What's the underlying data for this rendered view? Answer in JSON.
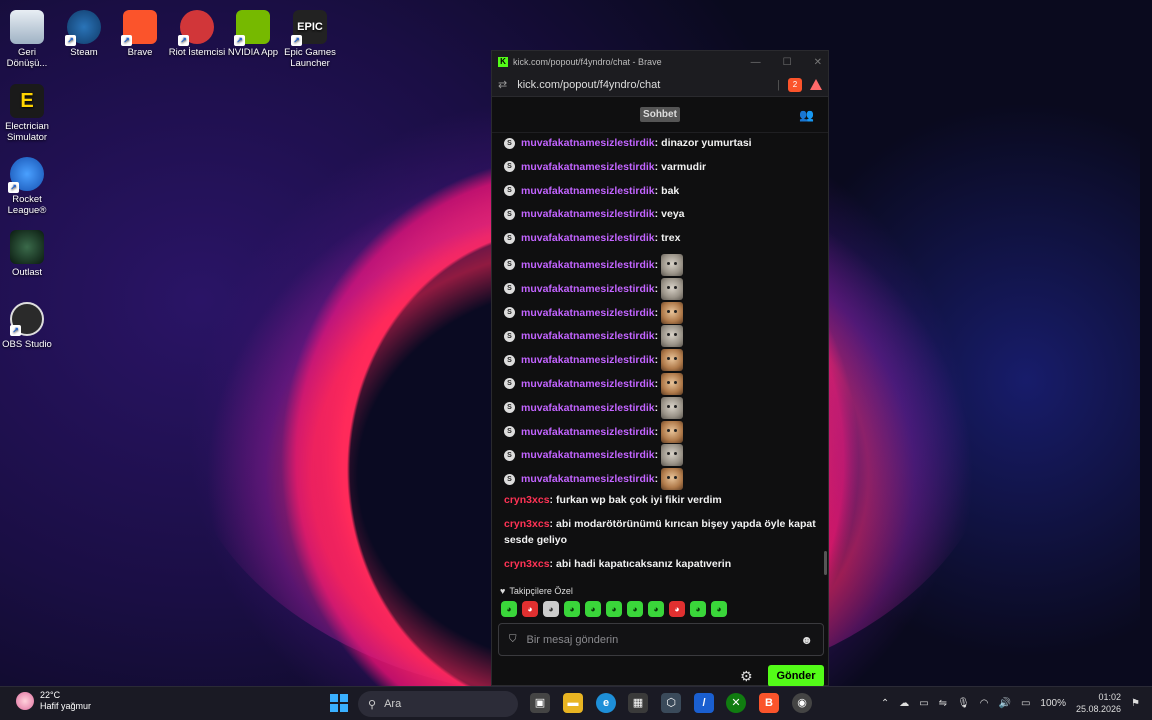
{
  "desktop": {
    "icons": [
      {
        "label": "Geri Dönüşü...",
        "icon": "recycle-bin-icon"
      },
      {
        "label": "Steam",
        "icon": "steam-icon"
      },
      {
        "label": "Brave",
        "icon": "brave-icon"
      },
      {
        "label": "Riot İstemcisi",
        "icon": "riot-icon"
      },
      {
        "label": "NVIDIA App",
        "icon": "nvidia-icon"
      },
      {
        "label": "Epic Games Launcher",
        "icon": "epic-games-icon"
      },
      {
        "label": "Electrician Simulator",
        "icon": "electrician-simulator-icon"
      },
      {
        "label": "Rocket League®",
        "icon": "rocket-league-icon"
      },
      {
        "label": "Outlast",
        "icon": "outlast-icon"
      },
      {
        "label": "OBS Studio",
        "icon": "obs-icon"
      }
    ],
    "epic_logo_text": "EPIC"
  },
  "browser": {
    "window_title": "kick.com/popout/f4yndro/chat - Brave",
    "url": "kick.com/popout/f4yndro/chat",
    "shield_count": "2",
    "accent": "#53fc18"
  },
  "chat": {
    "header_title": "Sohbet",
    "messages": [
      {
        "user": "muvafakatnamesizlestirdik",
        "text": "dinazor yumurtasi",
        "emote": null
      },
      {
        "user": "muvafakatnamesizlestirdik",
        "text": "varmudir",
        "emote": null
      },
      {
        "user": "muvafakatnamesizlestirdik",
        "text": "bak",
        "emote": null
      },
      {
        "user": "muvafakatnamesizlestirdik",
        "text": "veya",
        "emote": null
      },
      {
        "user": "muvafakatnamesizlestirdik",
        "text": "trex",
        "emote": null
      },
      {
        "user": "muvafakatnamesizlestirdik",
        "text": "",
        "emote": "cat-grey"
      },
      {
        "user": "muvafakatnamesizlestirdik",
        "text": "",
        "emote": "cat-grey"
      },
      {
        "user": "muvafakatnamesizlestirdik",
        "text": "",
        "emote": "cat-orange"
      },
      {
        "user": "muvafakatnamesizlestirdik",
        "text": "",
        "emote": "cat-grey"
      },
      {
        "user": "muvafakatnamesizlestirdik",
        "text": "",
        "emote": "cat-orange"
      },
      {
        "user": "muvafakatnamesizlestirdik",
        "text": "",
        "emote": "cat-orange"
      },
      {
        "user": "muvafakatnamesizlestirdik",
        "text": "",
        "emote": "cat-grey"
      },
      {
        "user": "muvafakatnamesizlestirdik",
        "text": "",
        "emote": "cat-orange"
      },
      {
        "user": "muvafakatnamesizlestirdik",
        "text": "",
        "emote": "cat-grey"
      },
      {
        "user": "muvafakatnamesizlestirdik",
        "text": "",
        "emote": "cat-orange"
      }
    ],
    "messages2": [
      {
        "user": "cryn3xcs",
        "text": "furkan wp bak çok iyi fikir verdim"
      },
      {
        "user": "cryn3xcs",
        "text": "abi modarötörünümü kırıcan bişey yapda öyle kapat sesde geliyo"
      },
      {
        "user": "cryn3xcs",
        "text": "abi hadi kapatıcaksanız kapatıverin"
      }
    ],
    "badge_letter": "S",
    "follower_label": "Takipçilere Özel",
    "emotes": [
      "green-emote",
      "red-emote",
      "grey-emote",
      "green-emote",
      "green-emote",
      "green-emote",
      "green-emote",
      "green-emote",
      "red-emote",
      "green-emote",
      "green-emote"
    ],
    "input_placeholder": "Bir mesaj gönderin",
    "send_label": "Gönder",
    "username_colors": {
      "muvafakatnamesizlestirdik": "#c264ff",
      "cryn3xcs": "#ff3355"
    }
  },
  "taskbar": {
    "weather_temp": "22°C",
    "weather_desc": "Hafif yağmur",
    "search_label": "Ara",
    "battery": "100%",
    "time": "01:02",
    "date": "25.08.2026"
  }
}
